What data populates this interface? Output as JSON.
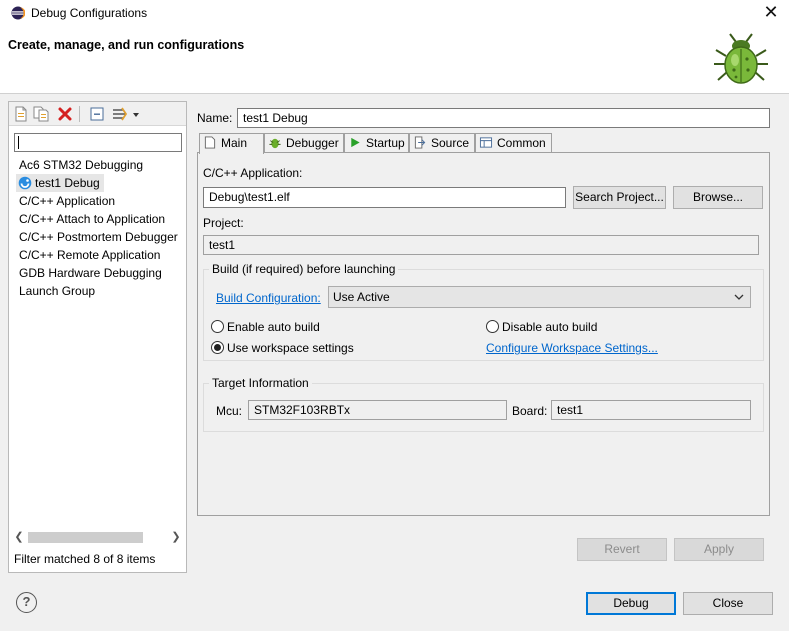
{
  "window": {
    "title": "Debug Configurations",
    "close_glyph": "✕",
    "icon": "eclipse-icon"
  },
  "header": {
    "title": "Create, manage, and run configurations",
    "image": "bug-icon"
  },
  "left": {
    "toolbar": [
      "new-config-icon",
      "duplicate-icon",
      "delete-icon",
      "collapse-all-icon",
      "filter-icon",
      "dropdown-icon"
    ],
    "filter_value": "",
    "tree": [
      {
        "label": "Ac6 STM32 Debugging"
      },
      {
        "label": "test1 Debug",
        "selected": true
      },
      {
        "label": "C/C++ Application"
      },
      {
        "label": "C/C++ Attach to Application"
      },
      {
        "label": "C/C++ Postmortem Debugger"
      },
      {
        "label": "C/C++ Remote Application"
      },
      {
        "label": "GDB Hardware Debugging"
      },
      {
        "label": "Launch Group"
      }
    ],
    "filter_status": "Filter matched 8 of 8 items"
  },
  "config": {
    "name_label": "Name:",
    "name_value": "test1 Debug",
    "tabs": [
      {
        "label": "Main",
        "icon": "main-icon",
        "active": true
      },
      {
        "label": "Debugger",
        "icon": "debugger-icon"
      },
      {
        "label": "Startup",
        "icon": "startup-icon"
      },
      {
        "label": "Source",
        "icon": "source-icon"
      },
      {
        "label": "Common",
        "icon": "common-icon"
      }
    ],
    "main": {
      "app_label": "C/C++ Application:",
      "app_value": "Debug\\test1.elf",
      "search_project": "Search Project...",
      "browse": "Browse...",
      "project_label": "Project:",
      "project_value": "test1",
      "build_group": "Build (if required) before launching",
      "build_config_link": "Build Configuration:",
      "build_config_value": "Use Active",
      "enable_auto_build": "Enable auto build",
      "disable_auto_build": "Disable auto build",
      "use_workspace": "Use workspace settings",
      "configure_workspace": "Configure Workspace Settings...",
      "selected_radio": "use_workspace",
      "target_group": "Target Information",
      "mcu_label": "Mcu:",
      "mcu_value": "STM32F103RBTx",
      "board_label": "Board:",
      "board_value": "test1"
    },
    "revert": "Revert",
    "apply": "Apply"
  },
  "footer": {
    "help": "?",
    "debug": "Debug",
    "close": "Close"
  }
}
